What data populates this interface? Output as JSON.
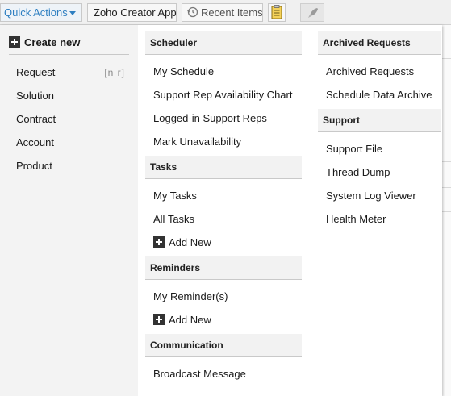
{
  "toolbar": {
    "quick_actions": "Quick Actions",
    "zoho_creator": "Zoho Creator App",
    "recent_items": "Recent Items"
  },
  "create_new": {
    "title": "Create new",
    "items": [
      {
        "label": "Request",
        "shortcut": "[n r]"
      },
      {
        "label": "Solution",
        "shortcut": ""
      },
      {
        "label": "Contract",
        "shortcut": ""
      },
      {
        "label": "Account",
        "shortcut": ""
      },
      {
        "label": "Product",
        "shortcut": ""
      }
    ]
  },
  "scheduler": {
    "title": "Scheduler",
    "items": [
      "My Schedule",
      "Support Rep Availability Chart",
      "Logged-in Support Reps",
      "Mark Unavailability"
    ]
  },
  "tasks": {
    "title": "Tasks",
    "items": [
      "My Tasks",
      "All Tasks"
    ],
    "add_new": "Add New"
  },
  "reminders": {
    "title": "Reminders",
    "items": [
      "My Reminder(s)"
    ],
    "add_new": "Add New"
  },
  "communication": {
    "title": "Communication",
    "items": [
      "Broadcast Message"
    ]
  },
  "archived": {
    "title": "Archived Requests",
    "items": [
      "Archived Requests",
      "Schedule Data Archive"
    ]
  },
  "support": {
    "title": "Support",
    "items": [
      "Support File",
      "Thread Dump",
      "System Log Viewer",
      "Health Meter"
    ]
  }
}
